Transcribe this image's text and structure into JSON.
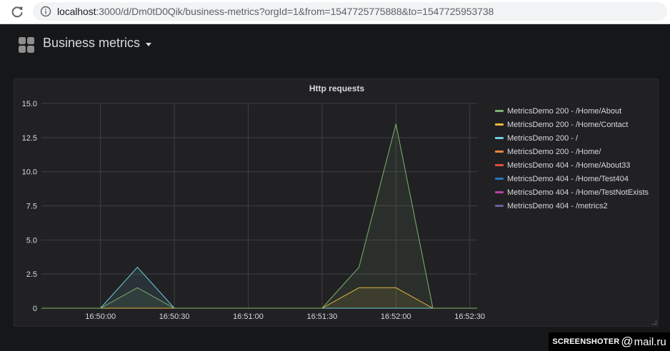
{
  "browser": {
    "url_host": "localhost",
    "url_rest": ":3000/d/Dm0tD0Qik/business-metrics?orgId=1&from=1547725775888&to=1547725953738"
  },
  "dashboard": {
    "title": "Business metrics"
  },
  "panel": {
    "title": "Http requests"
  },
  "chart_data": {
    "type": "area",
    "title": "Http requests",
    "xlabel": "",
    "ylabel": "",
    "x_range": [
      "16:49:36",
      "16:52:33"
    ],
    "ylim": [
      0,
      15
    ],
    "y_ticks": [
      "0",
      "2.5",
      "5.0",
      "7.5",
      "10.0",
      "12.5",
      "15.0"
    ],
    "x_ticks": [
      "16:50:00",
      "16:50:30",
      "16:51:00",
      "16:51:30",
      "16:52:00",
      "16:52:30"
    ],
    "grid": true,
    "legend_position": "right",
    "x": [
      "16:49:36",
      "16:50:00",
      "16:50:15",
      "16:50:30",
      "16:51:30",
      "16:51:45",
      "16:52:00",
      "16:52:15",
      "16:52:33"
    ],
    "series": [
      {
        "name": "MetricsDemo 200 - /Home/About",
        "color": "#7eb26d",
        "values": [
          0,
          0,
          1.5,
          0,
          0,
          3,
          13.5,
          0,
          0
        ]
      },
      {
        "name": "MetricsDemo 200 - /Home/Contact",
        "color": "#eab839",
        "values": [
          0,
          0,
          0,
          0,
          0,
          1.5,
          1.5,
          0,
          0
        ]
      },
      {
        "name": "MetricsDemo 200 - /",
        "color": "#6ed0e0",
        "values": [
          0,
          0,
          3,
          0,
          0,
          0,
          0,
          0,
          0
        ]
      },
      {
        "name": "MetricsDemo 200 - /Home/",
        "color": "#ef843c",
        "values": [
          0,
          0,
          0,
          0,
          0,
          0,
          0,
          0,
          0
        ]
      },
      {
        "name": "MetricsDemo 404 - /Home/About33",
        "color": "#e24d42",
        "values": [
          0,
          0,
          0,
          0,
          0,
          0,
          0,
          0,
          0
        ]
      },
      {
        "name": "MetricsDemo 404 - /Home/Test404",
        "color": "#1f78c1",
        "values": [
          0,
          0,
          0,
          0,
          0,
          0,
          0,
          0,
          0
        ]
      },
      {
        "name": "MetricsDemo 404 - /Home/TestNotExists",
        "color": "#ba43a9",
        "values": [
          0,
          0,
          0,
          0,
          0,
          0,
          0,
          0,
          0
        ]
      },
      {
        "name": "MetricsDemo 404 - /metrics2",
        "color": "#705da0",
        "values": [
          0,
          0,
          0,
          0,
          0,
          0,
          0,
          0,
          0
        ]
      }
    ]
  },
  "watermark": {
    "left": "SCREENSHOTER",
    "at": "@",
    "right": "mail.ru"
  }
}
